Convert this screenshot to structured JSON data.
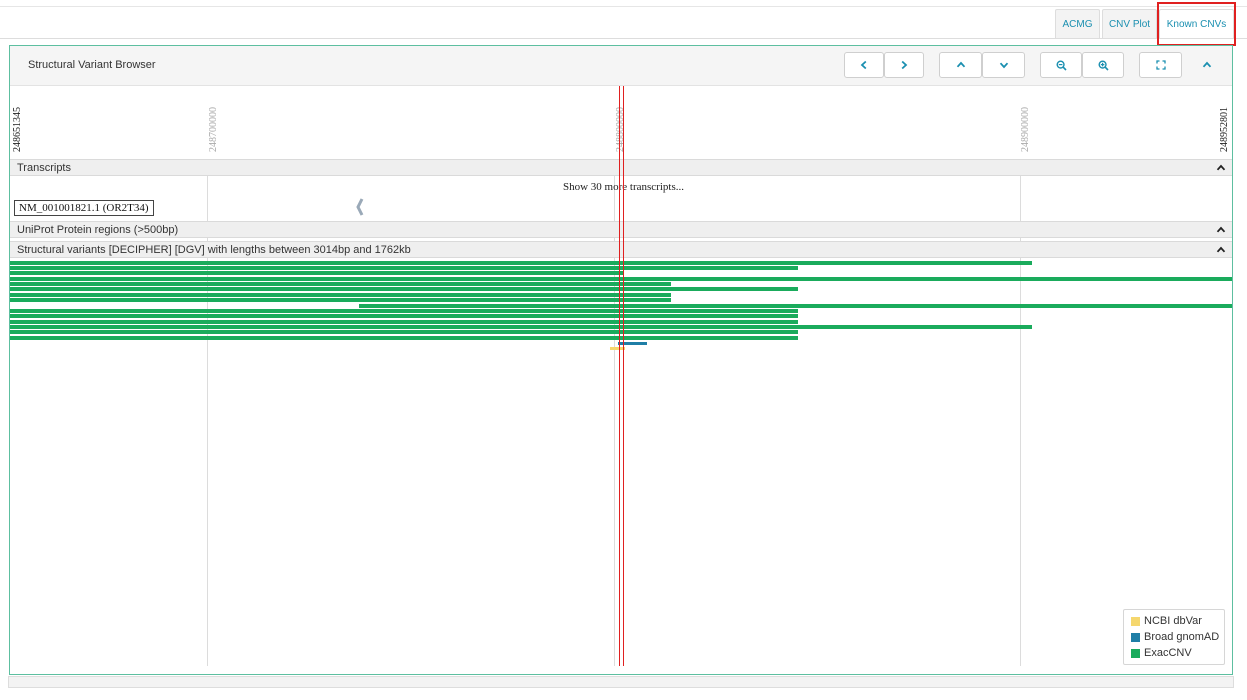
{
  "tabs": [
    {
      "label": "ACMG"
    },
    {
      "label": "CNV Plot"
    },
    {
      "label": "Known CNVs"
    }
  ],
  "browser": {
    "title": "Structural Variant Browser",
    "ruler": {
      "start": "248651345",
      "end": "248952801",
      "ticks": [
        "248700000",
        "248800000",
        "248900000"
      ]
    },
    "transcripts": {
      "section_label": "Transcripts",
      "more_link": "Show 30 more transcripts...",
      "gene_label": "NM_001001821.1 (OR2T34)"
    },
    "uniprot": {
      "section_label": "UniProt Protein regions (>500bp)"
    },
    "structural": {
      "section_label": "Structural variants [DECIPHER] [DGV] with lengths between 3014bp and 1762kb"
    },
    "legend": [
      {
        "label": "NCBI dbVar",
        "color": "#f5d76e"
      },
      {
        "label": "Broad gnomAD",
        "color": "#1f7ea6"
      },
      {
        "label": "ExacCNV",
        "color": "#1aab5c"
      }
    ]
  },
  "icons": [
    "chevron-left-icon",
    "chevron-right-icon",
    "chevron-up-icon",
    "chevron-down-icon",
    "zoom-out-icon",
    "zoom-in-icon",
    "fullscreen-icon",
    "collapse-icon"
  ],
  "colors": {
    "accent": "#1a8fb0",
    "panel_border": "#5dbfa0",
    "highlight": "#e02020",
    "exac": "#1aab5c",
    "gnomad": "#1f7ea6",
    "dbvar": "#f5d76e"
  }
}
